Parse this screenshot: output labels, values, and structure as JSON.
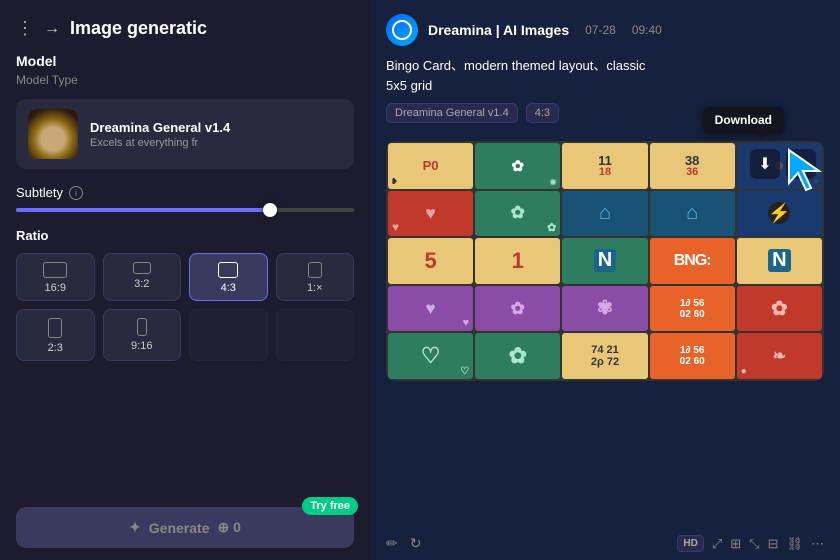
{
  "left": {
    "title": "Image generatic",
    "model_section": "Model",
    "model_type": "Model Type",
    "model_name": "Dreamina General v1.4",
    "model_desc": "Excels at everything fr",
    "subtlety_label": "Subtlety",
    "ratio_label": "Ratio",
    "ratios": [
      {
        "label": "16:9",
        "active": false,
        "shape": "wide"
      },
      {
        "label": "3:2",
        "active": false,
        "shape": "wide32"
      },
      {
        "label": "4:3",
        "active": true,
        "shape": "43"
      },
      {
        "label": "1:×",
        "active": false,
        "shape": "1t"
      }
    ],
    "ratios2": [
      {
        "label": "2:3",
        "active": false,
        "shape": "23"
      },
      {
        "label": "9:16",
        "active": false,
        "shape": "916"
      },
      {
        "label": "",
        "active": false,
        "shape": ""
      },
      {
        "label": "",
        "active": false,
        "shape": ""
      }
    ],
    "generate_label": "Generate",
    "generate_icon": "✦",
    "generate_count": "0",
    "try_free": "Try free"
  },
  "right": {
    "app_name": "Dreamina | AI Images",
    "chat_time_date": "07-28",
    "chat_time_hour": "09:40",
    "prompt_text": "Bingo Card、modern themed layout、classic\n5x5 grid",
    "tags": [
      "Dreamina General v1.4",
      "4:3"
    ],
    "download_tooltip": "Download",
    "footer_icons": [
      "edit",
      "refresh",
      "hd",
      "enhance",
      "resize1",
      "resize2",
      "crop",
      "link",
      "more"
    ]
  }
}
